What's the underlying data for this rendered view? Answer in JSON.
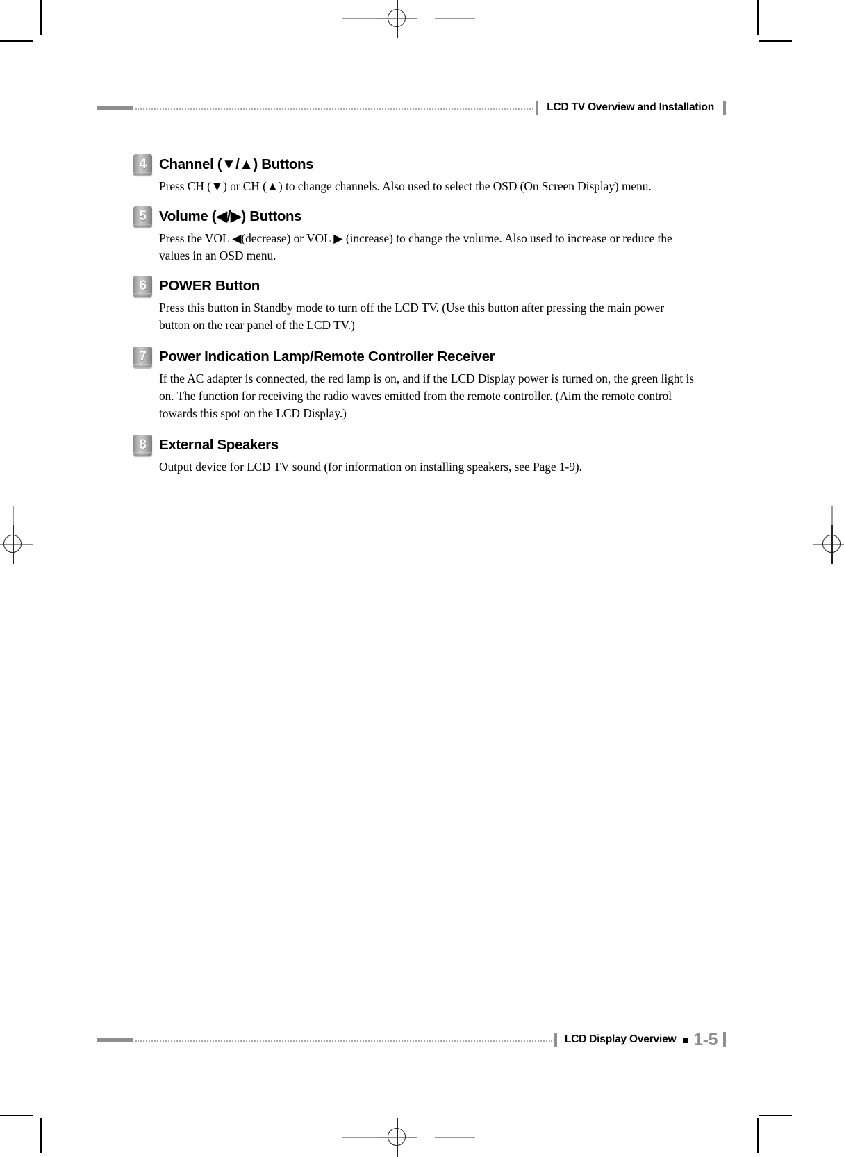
{
  "header": {
    "title": "LCD TV Overview and Installation"
  },
  "sections": [
    {
      "number": "4",
      "title": "Channel (▼/▲) Buttons",
      "body": "Press CH (▼) or CH (▲) to change channels. Also used to select the OSD (On Screen Display) menu."
    },
    {
      "number": "5",
      "title": "Volume (◀/▶) Buttons",
      "body": "Press the VOL ◀(decrease) or VOL ▶ (increase) to change the volume. Also used to increase or reduce the values in an OSD menu."
    },
    {
      "number": "6",
      "title": "POWER Button",
      "body": "Press this button in Standby mode to turn off the LCD TV. (Use this button after pressing the main power button on the rear panel of the LCD TV.)"
    },
    {
      "number": "7",
      "title": "Power Indication Lamp/Remote Controller Receiver",
      "body": "If the AC adapter is connected, the red lamp is on, and if the LCD Display power is turned on, the green light is on. The function for receiving the radio waves emitted from the remote controller. (Aim the remote control towards this spot on the LCD Display.)"
    },
    {
      "number": "8",
      "title": "External Speakers",
      "body": "Output device for LCD TV sound (for information on installing speakers, see Page 1-9)."
    }
  ],
  "footer": {
    "title": "LCD Display Overview",
    "page_number": "1-5"
  },
  "colors": {
    "rule_gray": "#8e8e8e",
    "dot_gray": "#aaaaaa",
    "badge_gray": "#b4b4b4",
    "text_black": "#000000"
  }
}
